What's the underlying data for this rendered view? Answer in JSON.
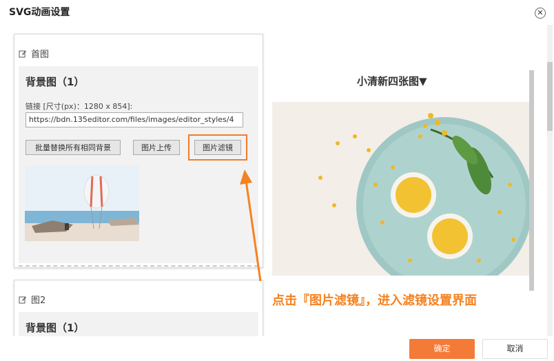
{
  "dialog": {
    "title": "SVG动画设置"
  },
  "cards": [
    {
      "heading": "首图",
      "panel_title": "背景图（1）",
      "link_label": "链接 [尺寸(px)：1280 x 854]:",
      "url_value": "https://bdn.135editor.com/files/images/editor_styles/4",
      "batch_button": "批量替换所有相同背景",
      "upload_button": "图片上传",
      "filter_button": "图片滤镜"
    },
    {
      "heading": "图2",
      "panel_title": "背景图（1）"
    }
  ],
  "preview": {
    "title": "小清新四张图▼"
  },
  "annotation": {
    "text": "点击『图片滤镜』，进入滤镜设置界面"
  },
  "footer": {
    "ok_label": "确定",
    "cancel_label": "取消"
  },
  "colors": {
    "accent": "#f47a37",
    "annotation": "#f58220"
  },
  "icons": {
    "edit": "edit-icon",
    "close": "close-icon"
  }
}
